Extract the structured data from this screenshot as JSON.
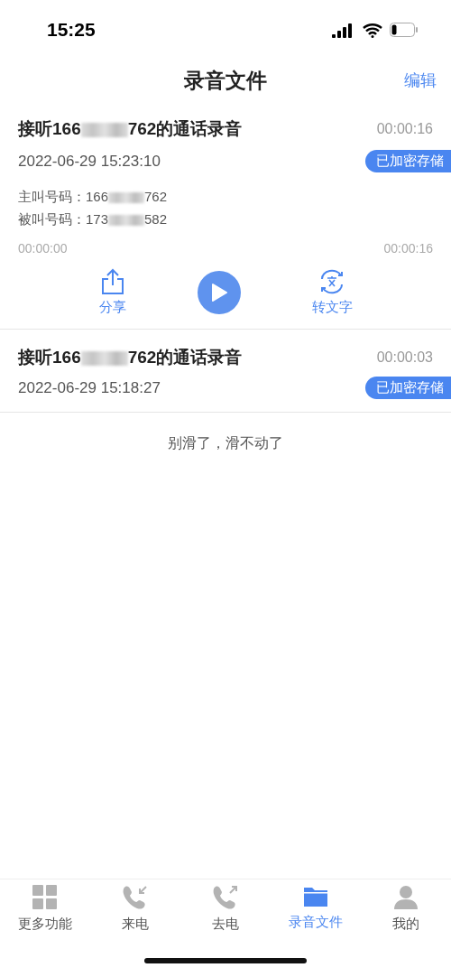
{
  "status_bar": {
    "time": "15:25"
  },
  "header": {
    "title": "录音文件",
    "action": "编辑"
  },
  "recordings": [
    {
      "title_start": "接听166",
      "title_end": "762的通话录音",
      "duration": "00:00:16",
      "datetime": "2022-06-29 15:23:10",
      "badge": "已加密存储",
      "expanded": true,
      "details": [
        {
          "label": "主叫号码：",
          "number_start": "166",
          "number_end": "762"
        },
        {
          "label": "被叫号码：",
          "number_start": "173",
          "number_end": "582"
        }
      ],
      "player": {
        "elapsed": "00:00:00",
        "total": "00:00:16",
        "playing": false
      },
      "actions": [
        {
          "kind": "share",
          "label": "分享"
        },
        {
          "kind": "transcribe",
          "label": "转文字"
        }
      ]
    },
    {
      "title_start": "接听166",
      "title_end": "762的通话录音",
      "duration": "00:00:03",
      "datetime": "2022-06-29 15:18:27",
      "badge": "已加密存储",
      "expanded": false
    }
  ],
  "end_note": "别滑了，滑不动了",
  "tabs": [
    {
      "kind": "grid",
      "label": "更多功能",
      "selected": false
    },
    {
      "kind": "incoming",
      "label": "来电",
      "selected": false
    },
    {
      "kind": "outgoing",
      "label": "去电",
      "selected": false
    },
    {
      "kind": "folder",
      "label": "录音文件",
      "selected": true
    },
    {
      "kind": "person",
      "label": "我的",
      "selected": false
    }
  ]
}
